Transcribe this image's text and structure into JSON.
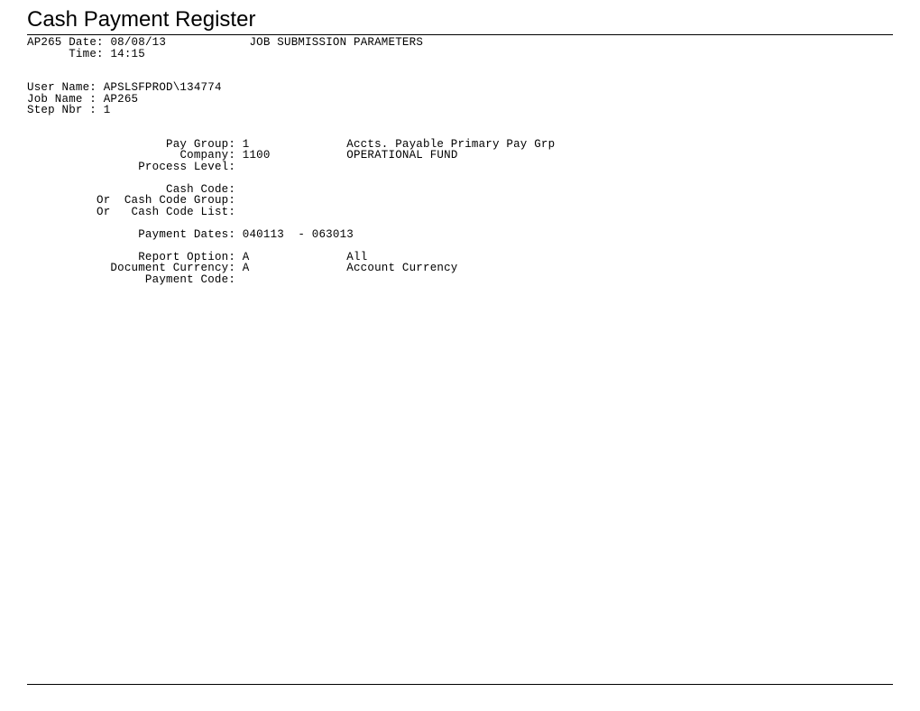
{
  "title": "Cash Payment Register",
  "header": {
    "report_id": "AP265",
    "date_label": "Date:",
    "date": "08/08/13",
    "section_label": "JOB SUBMISSION PARAMETERS",
    "time_label": "Time:",
    "time": "14:15"
  },
  "job": {
    "user_name_label": "User Name:",
    "user_name": "APSLSFPROD\\134774",
    "job_name_label": "Job Name :",
    "job_name": "AP265",
    "step_nbr_label": "Step Nbr :",
    "step_nbr": "1"
  },
  "params": {
    "pay_group_label": "Pay Group:",
    "pay_group": "1",
    "pay_group_desc": "Accts. Payable Primary Pay Grp",
    "company_label": "Company:",
    "company": "1100",
    "company_desc": "OPERATIONAL FUND",
    "process_level_label": "Process Level:",
    "process_level": "",
    "cash_code_label": "Cash Code:",
    "cash_code": "",
    "or1": "Or",
    "cash_code_group_label": "Cash Code Group:",
    "cash_code_group": "",
    "or2": "Or",
    "cash_code_list_label": "Cash Code List:",
    "cash_code_list": "",
    "payment_dates_label": "Payment Dates:",
    "payment_dates": "040113  - 063013",
    "report_option_label": "Report Option:",
    "report_option": "A",
    "report_option_desc": "All",
    "doc_currency_label": "Document Currency:",
    "doc_currency": "A",
    "doc_currency_desc": "Account Currency",
    "payment_code_label": "Payment Code:",
    "payment_code": ""
  }
}
